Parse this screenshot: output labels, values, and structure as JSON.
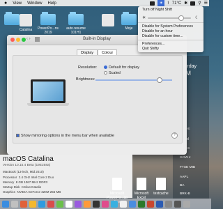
{
  "menubar": {
    "apple": "",
    "items": [
      "View",
      "Window",
      "Help"
    ],
    "temperature": "71°C"
  },
  "desktop_icons": [
    {
      "label": "",
      "kind": "folder"
    },
    {
      "label": "Catalina",
      "kind": "drive"
    },
    {
      "label": "PowerPo...ns 2019",
      "kind": "folder"
    },
    {
      "label": "auto.resume 101H1",
      "kind": "folder"
    },
    {
      "label": "",
      "kind": "drive"
    },
    {
      "label": "Moje",
      "kind": "folder"
    }
  ],
  "shifty_menu": {
    "toggle_label": "Turn off Night Shift",
    "items": [
      "Disable for System Preferences",
      "Disable for an hour",
      "Disable for custom time...",
      "Preferences...",
      "Quit Shifty"
    ],
    "brightness_fraction": 0.72
  },
  "window": {
    "title": "Built-in Display",
    "search_placeholder": "Search",
    "tabs": [
      "Display",
      "Colour"
    ],
    "active_tab": "Colour",
    "resolution_label": "Resolution:",
    "resolution_options": [
      "Default for display",
      "Scaled"
    ],
    "selected_resolution": "Default for display",
    "brightness_label": "Brightness:",
    "brightness_fraction": 0.8,
    "mirroring_label": "Show mirroring options in the menu bar when available",
    "mirroring_checked": true,
    "help": "?"
  },
  "about": {
    "os_name": "macOS Catalina",
    "version": "Version 10.15.4 Beta (19E258a)",
    "rows": [
      {
        "label": "MacBook (13-inch, Mid 2010)"
      },
      {
        "label": "Processor",
        "value": "2.4 GHz Intel Core 2 Duo"
      },
      {
        "label": "Memory",
        "value": "8 GB 1067 MHz DDR3"
      },
      {
        "label": "Startup Disk",
        "value": "KSilverCatalin"
      },
      {
        "label": "Graphics",
        "value": "NVIDIA GeForce 320M 256 MB"
      }
    ]
  },
  "notification_center": {
    "day": "Saturday",
    "date": "14 M",
    "weather_head": "WEATHE",
    "add_label": "Add",
    "stocks_head": "STOCKS",
    "stocks": [
      "DOW J",
      "FTSE MIB",
      "AAPL",
      "BA",
      "BRK-B"
    ]
  },
  "bottom_files": [
    {
      "label": "Microsoft PowerPo...pp files"
    },
    {
      "label": "Microsoft Excel"
    },
    {
      "label": "textcache"
    }
  ]
}
